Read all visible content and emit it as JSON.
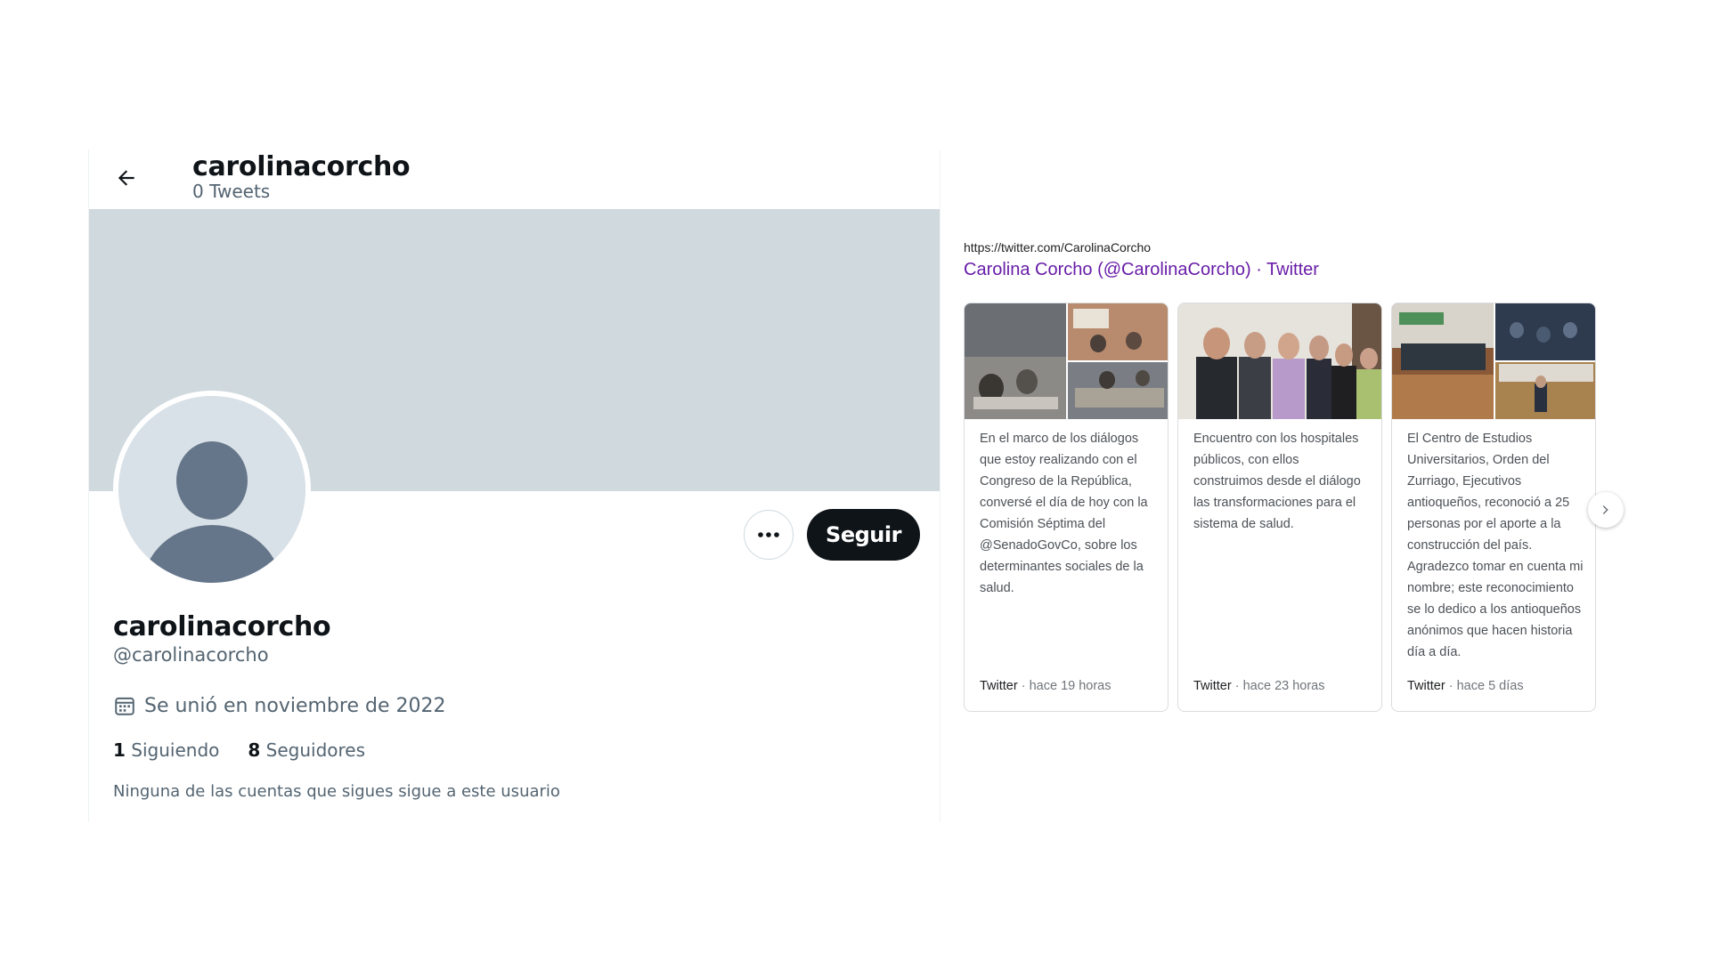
{
  "profile": {
    "header_name": "carolinacorcho",
    "header_tweets": "0 Tweets",
    "display_name": "carolinacorcho",
    "handle": "@carolinacorcho",
    "joined": "Se unió en noviembre de 2022",
    "following_count": "1",
    "following_label": "Siguiendo",
    "followers_count": "8",
    "followers_label": "Seguidores",
    "mutual_note": "Ninguna de las cuentas que sigues sigue a este usuario",
    "follow_label": "Seguir",
    "colors": {
      "banner": "#cfd9de",
      "follow_bg": "#0f1419",
      "secondary_text": "#536471"
    }
  },
  "result": {
    "url": "https://twitter.com/CarolinaCorcho",
    "title": "Carolina Corcho (@CarolinaCorcho) · Twitter",
    "title_color": "#681da8"
  },
  "cards": [
    {
      "text": "En el marco de los diálogos que estoy realizando con el Congreso de la República, conversé el día de hoy con la Comisión Séptima del @SenadoGovCo, sobre los determinantes sociales de la salud.",
      "source": "Twitter",
      "sep": " · ",
      "time": "hace 19 horas"
    },
    {
      "text": "Encuentro con los hospitales públicos, con ellos construimos desde el diálogo las transformaciones para el sistema de salud.",
      "source": "Twitter",
      "sep": " · ",
      "time": "hace 23 horas"
    },
    {
      "text": "El Centro de Estudios Universitarios, Orden del Zurriago, Ejecutivos antioqueños, reconoció a 25 personas por el aporte a la construcción del país. Agradezco tomar en cuenta mi nombre; este reconocimiento se lo dedico a los antioqueños anónimos que hacen historia día a día.",
      "source": "Twitter",
      "sep": " · ",
      "time": "hace 5 días"
    }
  ],
  "icons": {
    "back": "arrow-left-icon",
    "more": "ellipsis-icon",
    "calendar": "calendar-icon",
    "next": "chevron-right-icon"
  }
}
